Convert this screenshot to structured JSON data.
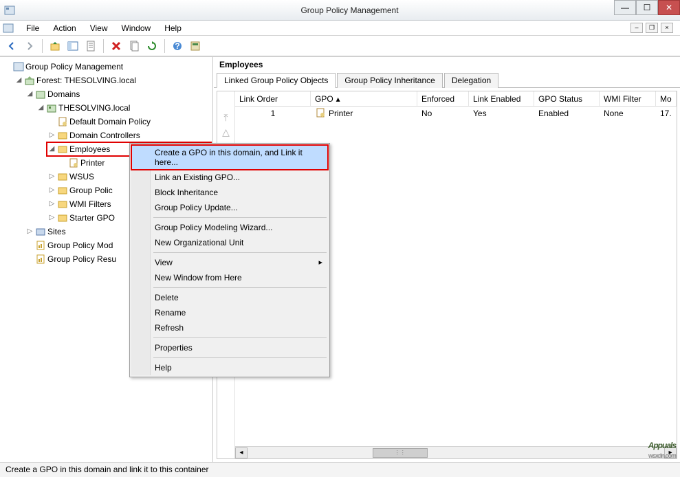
{
  "window": {
    "title": "Group Policy Management"
  },
  "menus": {
    "file": "File",
    "action": "Action",
    "view": "View",
    "window": "Window",
    "help": "Help"
  },
  "tree": {
    "root": "Group Policy Management",
    "forest": "Forest: THESOLVING.local",
    "domains": "Domains",
    "domain": "THESOLVING.local",
    "default_policy": "Default Domain Policy",
    "domain_controllers": "Domain Controllers",
    "employees": "Employees",
    "printer": "Printer",
    "wsus": "WSUS",
    "gpo": "Group Polic",
    "wmi": "WMI Filters",
    "starter": "Starter GPO",
    "sites": "Sites",
    "gpm": "Group Policy Mod",
    "gpr": "Group Policy Resu"
  },
  "detail": {
    "title": "Employees",
    "tabs": {
      "linked": "Linked Group Policy Objects",
      "inh": "Group Policy Inheritance",
      "del": "Delegation"
    },
    "headers": {
      "order": "Link Order",
      "gpo": "GPO",
      "enforced": "Enforced",
      "linkenabled": "Link Enabled",
      "status": "GPO Status",
      "wmi": "WMI Filter",
      "mod": "Mo"
    },
    "row": {
      "order": "1",
      "gpo": "Printer",
      "enforced": "No",
      "linkenabled": "Yes",
      "status": "Enabled",
      "wmi": "None",
      "mod": "17."
    }
  },
  "context": {
    "create": "Create a GPO in this domain, and Link it here...",
    "linkexisting": "Link an Existing GPO...",
    "block": "Block Inheritance",
    "update": "Group Policy Update...",
    "modeling": "Group Policy Modeling Wizard...",
    "newou": "New Organizational Unit",
    "view": "View",
    "newwin": "New Window from Here",
    "delete": "Delete",
    "rename": "Rename",
    "refresh": "Refresh",
    "properties": "Properties",
    "help": "Help"
  },
  "status": "Create a GPO in this domain and link it to this container",
  "watermark": "Appuals",
  "watermark_sub": "wsxdn.com"
}
